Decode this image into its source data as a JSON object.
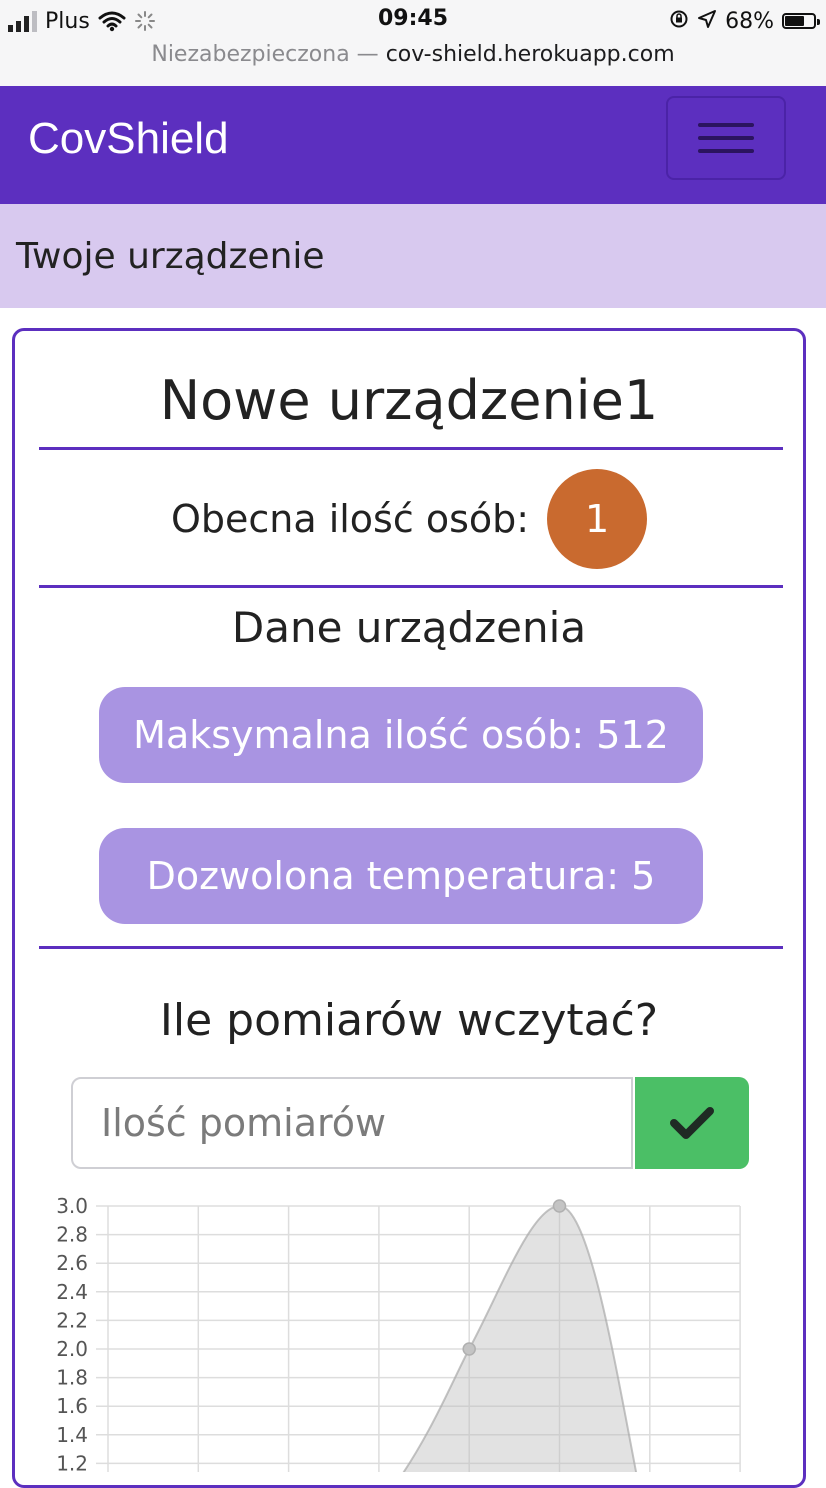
{
  "status_bar": {
    "carrier": "Plus",
    "time": "09:45",
    "battery_percent": "68%",
    "battery_level": 0.68,
    "url_prefix": "Niezabezpieczona —",
    "url_host": "cov-shield.herokuapp.com"
  },
  "navbar": {
    "brand": "CovShield"
  },
  "breadcrumb": {
    "label": "Twoje urządzenie"
  },
  "device": {
    "name": "Nowe urządzenie1",
    "count_label": "Obecna ilość osób:",
    "count_value": "1",
    "section_title": "Dane urządzenia",
    "max_people": "Maksymalna ilość osób: 512",
    "allowed_temp": "Dozwolona temperatura: 5",
    "question": "Ile pomiarów wczytać?",
    "input_placeholder": "Ilość pomiarów",
    "input_value": ""
  },
  "colors": {
    "navbar": "#5c2fbf",
    "breadcrumb_bg": "#d8c9ef",
    "badge": "#c96a2f",
    "pill": "#a994e2",
    "confirm": "#4bbf66"
  },
  "chart_data": {
    "type": "area",
    "y_ticks": [
      "3.0",
      "2.8",
      "2.6",
      "2.4",
      "2.2",
      "2.0",
      "1.8",
      "1.6",
      "1.4",
      "1.2"
    ],
    "points": [
      {
        "x": 4,
        "y": 2.0
      },
      {
        "x": 5,
        "y": 3.0
      }
    ],
    "ylim": [
      1.2,
      3.0
    ],
    "grid": true
  }
}
